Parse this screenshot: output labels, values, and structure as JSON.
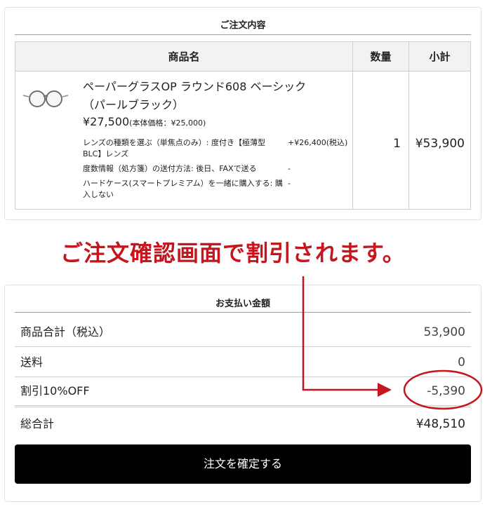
{
  "order": {
    "section_title": "ご注文内容",
    "headers": {
      "name": "商品名",
      "qty": "数量",
      "subtotal": "小計"
    },
    "item": {
      "thumbnail_icon": "round-glasses-icon",
      "name_line1": "ペーパーグラスOP ラウンド608 ベーシック",
      "name_line2": "（パールブラック）",
      "price": "¥27,500",
      "price_note": "(本体価格：¥25,000)",
      "options": [
        {
          "label": "レンズの種類を選ぶ（単焦点のみ）: 度付き【極薄型 BLC】レンズ",
          "value": "+¥26,400(税込)"
        },
        {
          "label": "度数情報（処方箋）の送付方法: 後日、FAXで送る",
          "value": "-"
        },
        {
          "label": "ハードケース(スマートプレミアム）を一緒に購入する: 購入しない",
          "value": "-"
        }
      ],
      "qty": "1",
      "subtotal": "¥53,900"
    }
  },
  "annotation": {
    "text": "ご注文確認画面で割引されます。",
    "color": "#c4161c"
  },
  "payment": {
    "section_title": "お支払い金額",
    "rows": [
      {
        "label": "商品合計（税込）",
        "value": "53,900"
      },
      {
        "label": "送料",
        "value": "0"
      },
      {
        "label": "割引10%OFF",
        "value": "-5,390"
      },
      {
        "label": "総合計",
        "value": "¥48,510"
      }
    ],
    "confirm_label": "注文を確定する"
  }
}
